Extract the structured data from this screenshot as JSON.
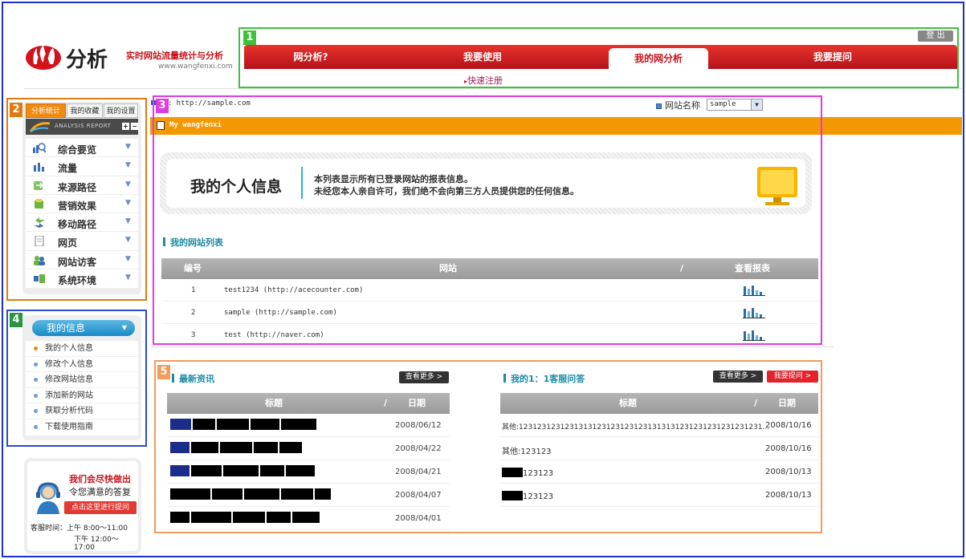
{
  "header": {
    "brand": "分析",
    "tagline": "实时网站流量统计与分析",
    "url": "www.wangfenxi.com",
    "logout": "登 出",
    "nav": [
      "网分析?",
      "我要使用",
      "我的网分析",
      "我要提问"
    ],
    "quick_register": "快速注册"
  },
  "box_labels": [
    "1",
    "2",
    "3",
    "4",
    "5"
  ],
  "sidebar": {
    "tabs": [
      "分析统计",
      "我的收藏",
      "我的设置"
    ],
    "report_label": "ANALYSIS REPORT",
    "menu": [
      "综合要览",
      "流量",
      "来源路径",
      "营销效果",
      "移动路径",
      "网页",
      "网站访客",
      "系统环境"
    ]
  },
  "myinfo": {
    "title": "我的信息",
    "items": [
      "我的个人信息",
      "修改个人信息",
      "修改网站信息",
      "添加新的网站",
      "获取分析代码",
      "下载使用指南"
    ]
  },
  "support": {
    "line1": "我们会尽快做出",
    "line2": "令您满意的答复",
    "button": "点击这里进行提问",
    "hours1": "客服时间：上午 8:00～11:00",
    "hours2": "下午 12:00～17:00"
  },
  "main": {
    "url_label": "L : http://sample.com",
    "site_name_label": "网站名称",
    "site_select": "sample",
    "banner": "My wangfenxi",
    "info_title": "我的个人信息",
    "info_desc1": "本列表显示所有已登录网站的报表信息。",
    "info_desc2": "未经您本人亲自许可，我们绝不会向第三方人员提供您的任何信息。",
    "site_list_title": "我的网站列表",
    "site_table_headers": [
      "编号",
      "网站",
      "/",
      "查看报表"
    ],
    "sites": [
      {
        "no": "1",
        "site": "test1234 (http://acecounter.com)"
      },
      {
        "no": "2",
        "site": "sample (http://sample.com)"
      },
      {
        "no": "3",
        "site": "test (http://naver.com)"
      }
    ]
  },
  "news": {
    "title": "最新资讯",
    "more": "查看更多 >",
    "headers": [
      "标题",
      "/",
      "日期"
    ],
    "dates": [
      "2008/06/12",
      "2008/04/22",
      "2008/04/21",
      "2008/04/07",
      "2008/04/01"
    ]
  },
  "faq": {
    "title": "我的1：1客服问答",
    "more": "查看更多 >",
    "ask": "我要提问 >",
    "headers": [
      "标题",
      "/",
      "日期"
    ],
    "rows": [
      {
        "q": "其他:12312312312313131231231231231313131231231231231231231...",
        "date": "2008/10/16"
      },
      {
        "q": "其他:123123",
        "date": "2008/10/16"
      },
      {
        "q": "123123",
        "date": "2008/10/13"
      },
      {
        "q": "123123",
        "date": "2008/10/13"
      }
    ]
  },
  "colors": {
    "frame": "#1c2fc6",
    "box1": "#3fc13a",
    "box2": "#e07a12",
    "box3": "#e13ae2",
    "box4": "#2b4bc8",
    "box5": "#f29b5b",
    "nav_red": "#c4121a",
    "banner_orange": "#f39800"
  }
}
